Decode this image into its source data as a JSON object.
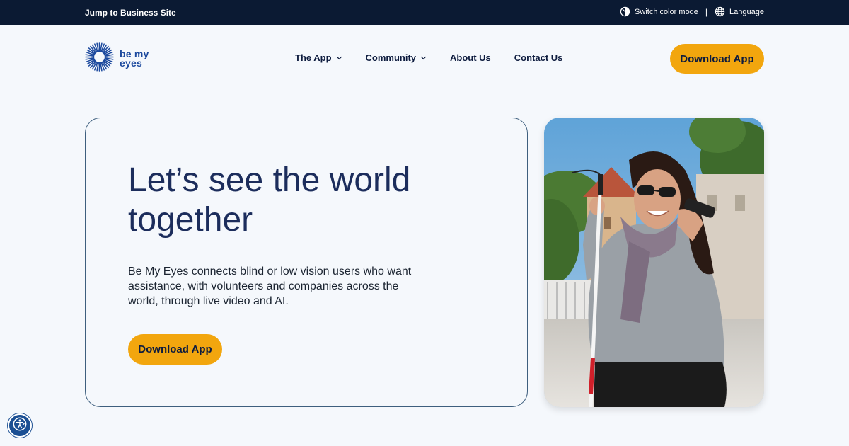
{
  "topbar": {
    "jump_label": "Jump to Business Site",
    "color_mode_label": "Switch color mode",
    "separator": "|",
    "language_label": "Language"
  },
  "brand": {
    "logo_text_line1": "be my",
    "logo_text_line2": "eyes",
    "accent_color": "#1d4a9e"
  },
  "nav": {
    "items": [
      {
        "label": "The App",
        "has_dropdown": true
      },
      {
        "label": "Community",
        "has_dropdown": true
      },
      {
        "label": "About Us",
        "has_dropdown": false
      },
      {
        "label": "Contact Us",
        "has_dropdown": false
      }
    ],
    "cta_label": "Download App"
  },
  "hero": {
    "title": "Let’s see the world together",
    "description": "Be My Eyes connects blind or low vision users who want assistance, with volunteers and companies across the world, through live video and AI.",
    "cta_label": "Download App",
    "image_icon": "photo-woman-with-white-cane-on-phone"
  },
  "colors": {
    "topbar_bg": "#0b1a33",
    "page_bg": "#f5f8fc",
    "button_bg": "#f2a60e",
    "heading": "#1c2d5c"
  },
  "widgets": {
    "accessibility_icon": "accessibility-icon"
  }
}
